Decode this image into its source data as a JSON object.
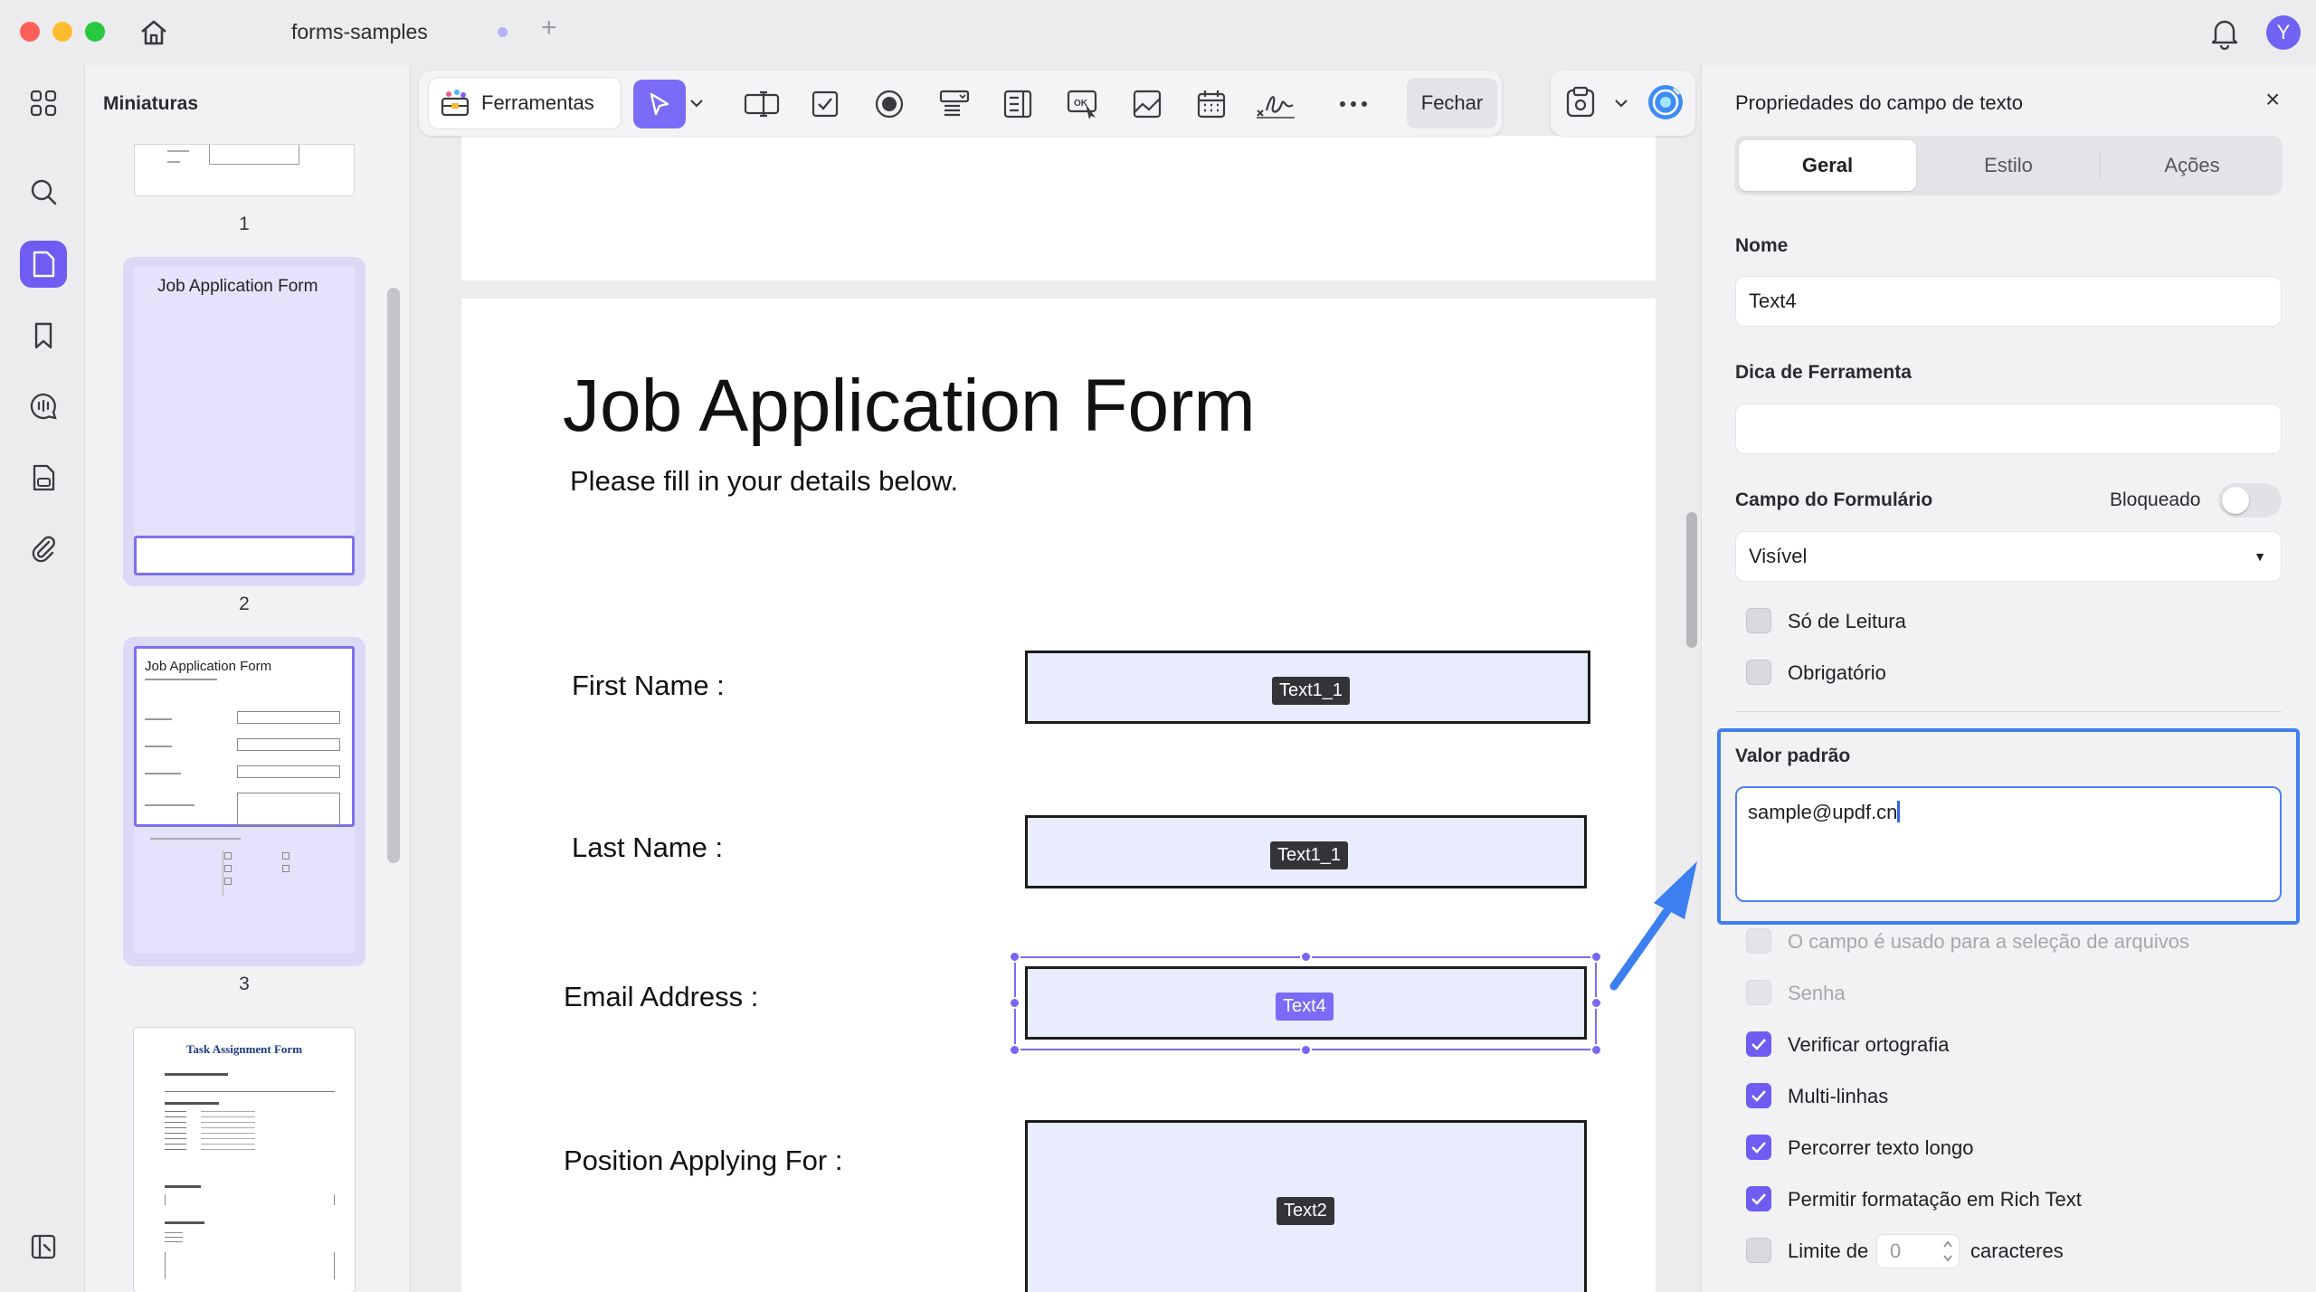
{
  "window": {
    "tab_title": "forms-samples",
    "avatar_letter": "Y"
  },
  "thumbnails": {
    "title": "Miniaturas",
    "pages": [
      {
        "number": "1"
      },
      {
        "number": "2",
        "heading": "Job Application Form"
      },
      {
        "number": "3",
        "heading": "Job Application Form"
      },
      {
        "number": "",
        "heading": "Task Assignment Form"
      }
    ]
  },
  "toolbar": {
    "tools_label": "Ferramentas",
    "close_label": "Fechar"
  },
  "document": {
    "title": "Job Application Form",
    "subtitle": "Please fill in your details below.",
    "fields": [
      {
        "label": "First Name :",
        "tag": "Text1_1"
      },
      {
        "label": "Last Name :",
        "tag": "Text1_1"
      },
      {
        "label": "Email Address :",
        "tag": "Text4",
        "selected": true
      },
      {
        "label": "Position Applying For :",
        "tag": "Text2"
      }
    ]
  },
  "properties": {
    "title": "Propriedades do campo de texto",
    "tabs": [
      "Geral",
      "Estilo",
      "Ações"
    ],
    "active_tab": "Geral",
    "name_label": "Nome",
    "name_value": "Text4",
    "tooltip_label": "Dica de Ferramenta",
    "tooltip_value": "",
    "form_field_label": "Campo do Formulário",
    "locked_label": "Bloqueado",
    "locked": false,
    "visibility_value": "Visível",
    "readonly_label": "Só de Leitura",
    "required_label": "Obrigatório",
    "default_value_label": "Valor padrão",
    "default_value": "sample@updf.cn",
    "file_select_label": "O campo é usado para a seleção de arquivos",
    "password_label": "Senha",
    "spellcheck_label": "Verificar ortografia",
    "multiline_label": "Multi-linhas",
    "scroll_label": "Percorrer texto longo",
    "richtext_label": "Permitir formatação em Rich Text",
    "limit_label": "Limite de",
    "limit_value": "0",
    "limit_suffix": "caracteres",
    "checkboxes": {
      "readonly": false,
      "required": false,
      "file_select": false,
      "password": false,
      "spellcheck": true,
      "multiline": true,
      "scroll": true,
      "richtext": true,
      "limit": false
    }
  },
  "colors": {
    "accent": "#6f5cf2",
    "highlight": "#3d7ef0",
    "field_fill": "#e8ecfd"
  }
}
